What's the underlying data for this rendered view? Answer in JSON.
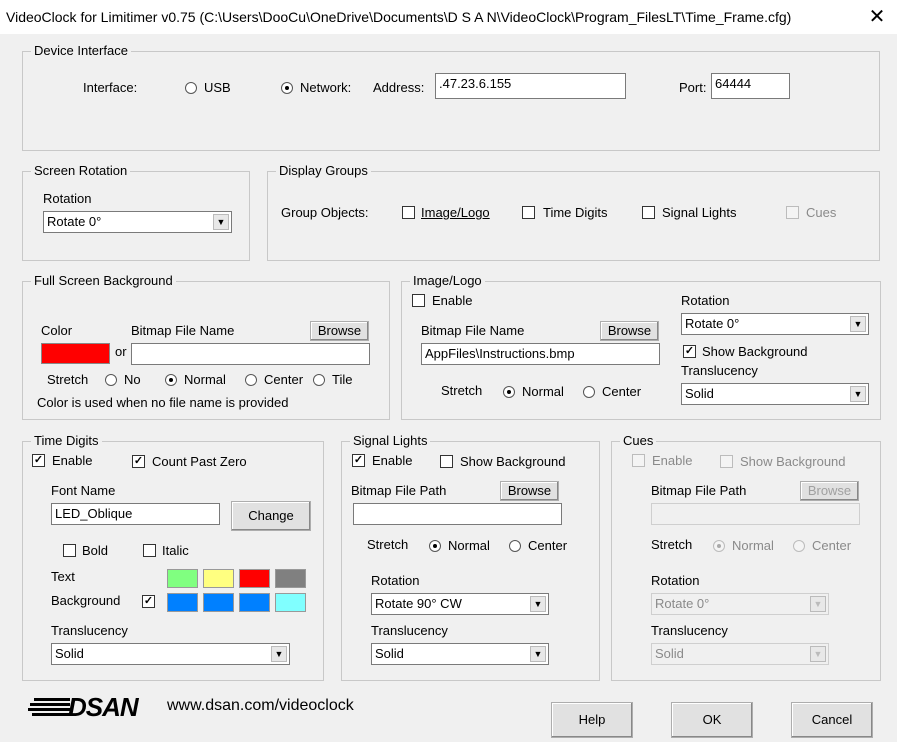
{
  "window": {
    "title": "VideoClock for Limitimer v0.75 (C:\\Users\\DooCu\\OneDrive\\Documents\\D S A N\\VideoClock\\Program_FilesLT\\Time_Frame.cfg)",
    "close_glyph": "✕"
  },
  "device": {
    "legend": "Device Interface",
    "interface_label": "Interface:",
    "usb_label": "USB",
    "network_label": "Network:",
    "address_label": "Address:",
    "address_value": ".47.23.6.155",
    "port_label": "Port:",
    "port_value": "64444"
  },
  "screen_rotation": {
    "legend": "Screen Rotation",
    "rotation_label": "Rotation",
    "rotation_value": "Rotate 0°"
  },
  "display_groups": {
    "legend": "Display Groups",
    "group_objects_label": "Group Objects:",
    "image_logo": "Image/Logo",
    "time_digits": "Time Digits",
    "signal_lights": "Signal Lights",
    "cues": "Cues"
  },
  "full_bg": {
    "legend": "Full Screen Background",
    "color_label": "Color",
    "bitmap_label": "Bitmap File Name",
    "browse": "Browse",
    "or": "or",
    "color": "#ff0000",
    "stretch_label": "Stretch",
    "no": "No",
    "normal": "Normal",
    "center": "Center",
    "tile": "Tile",
    "note": "Color is used when no file name is provided"
  },
  "image_logo": {
    "legend": "Image/Logo",
    "enable": "Enable",
    "bitmap_label": "Bitmap File Name",
    "browse": "Browse",
    "file_value": "AppFiles\\Instructions.bmp",
    "stretch_label": "Stretch",
    "normal": "Normal",
    "center": "Center",
    "rotation_label": "Rotation",
    "rotation_value": "Rotate 0°",
    "show_bg": "Show Background",
    "translucency_label": "Translucency",
    "translucency_value": "Solid"
  },
  "time_digits": {
    "legend": "Time Digits",
    "enable": "Enable",
    "count_past_zero": "Count Past Zero",
    "font_name_label": "Font Name",
    "font_name_value": "LED_Oblique",
    "change": "Change",
    "bold": "Bold",
    "italic": "Italic",
    "text_label": "Text",
    "background_label": "Background",
    "text_colors": [
      "#80ff80",
      "#ffff80",
      "#ff0000",
      "#808080"
    ],
    "bg_colors": [
      "#0080ff",
      "#0080ff",
      "#0080ff",
      "#80ffff"
    ],
    "translucency_label": "Translucency",
    "translucency_value": "Solid"
  },
  "signal_lights": {
    "legend": "Signal Lights",
    "enable": "Enable",
    "show_bg": "Show Background",
    "bitmap_label": "Bitmap File Path",
    "browse": "Browse",
    "file_value": "",
    "stretch_label": "Stretch",
    "normal": "Normal",
    "center": "Center",
    "rotation_label": "Rotation",
    "rotation_value": "Rotate 90° CW",
    "translucency_label": "Translucency",
    "translucency_value": "Solid"
  },
  "cues": {
    "legend": "Cues",
    "enable": "Enable",
    "show_bg": "Show Background",
    "bitmap_label": "Bitmap File Path",
    "browse": "Browse",
    "file_value": "",
    "stretch_label": "Stretch",
    "normal": "Normal",
    "center": "Center",
    "rotation_label": "Rotation",
    "rotation_value": "Rotate 0°",
    "translucency_label": "Translucency",
    "translucency_value": "Solid"
  },
  "footer": {
    "logo_text": "DSAN",
    "website": "www.dsan.com/videoclock",
    "help": "Help",
    "ok": "OK",
    "cancel": "Cancel"
  }
}
